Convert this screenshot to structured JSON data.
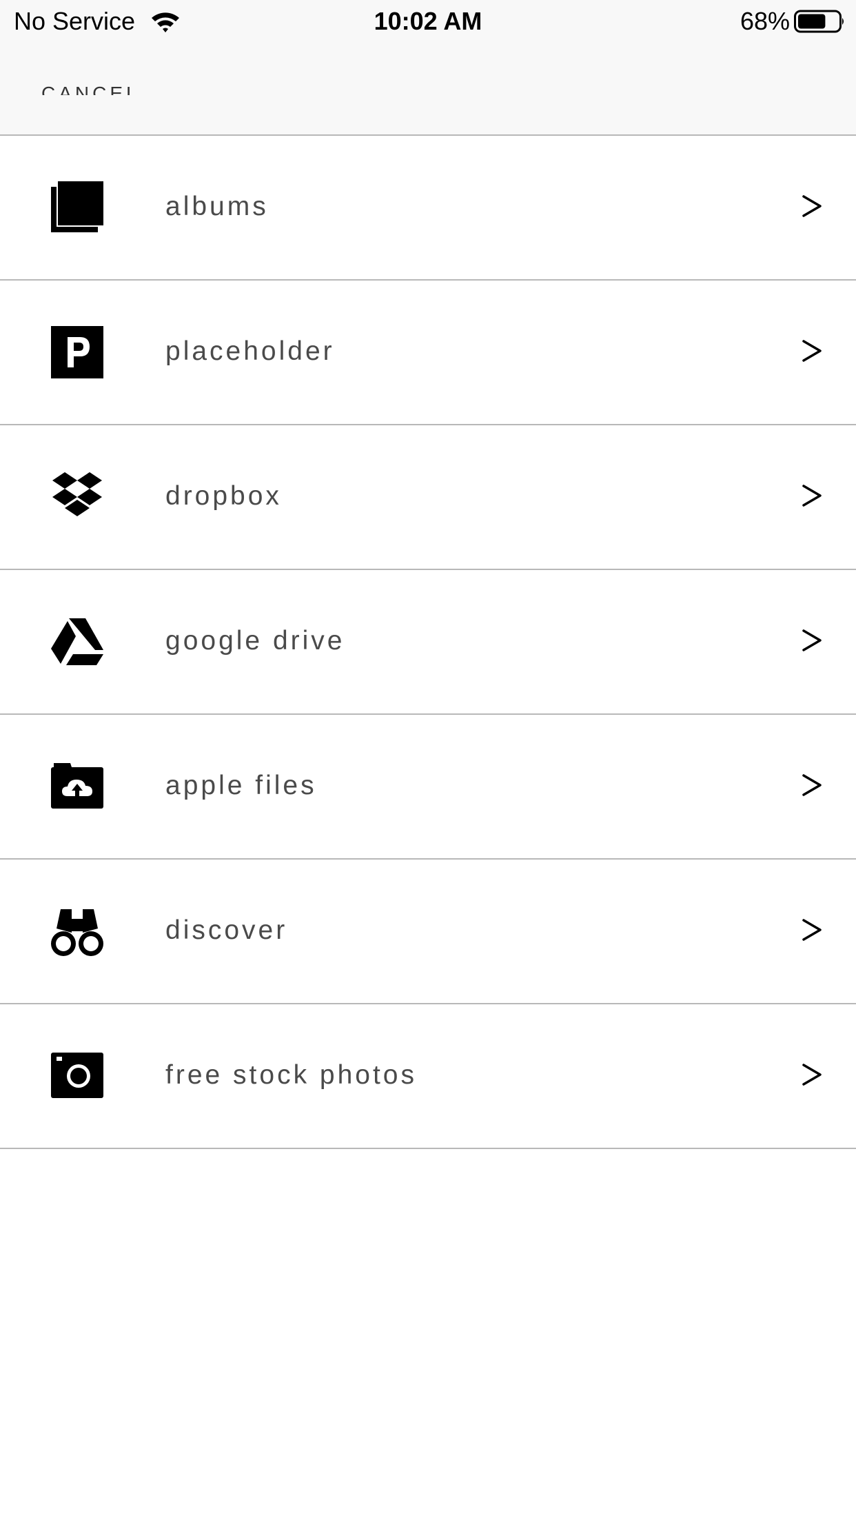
{
  "status_bar": {
    "carrier": "No Service",
    "time": "10:02 AM",
    "battery_percent": "68%",
    "battery_level": 0.68,
    "wifi_icon": "wifi-icon",
    "battery_icon": "battery-icon"
  },
  "nav": {
    "cancel_label": "CANCEL"
  },
  "menu": {
    "items": [
      {
        "label": "albums",
        "icon": "albums-icon"
      },
      {
        "label": "placeholder",
        "icon": "placeholder-icon"
      },
      {
        "label": "dropbox",
        "icon": "dropbox-icon"
      },
      {
        "label": "google drive",
        "icon": "google-drive-icon"
      },
      {
        "label": "apple files",
        "icon": "cloud-upload-folder-icon"
      },
      {
        "label": "discover",
        "icon": "binoculars-icon"
      },
      {
        "label": "free stock photos",
        "icon": "camera-icon"
      }
    ],
    "chevron": ">"
  },
  "colors": {
    "header_bg": "#f8f8f8",
    "divider": "#b8b8b8",
    "label": "#4a4a4a",
    "icon": "#000000"
  }
}
